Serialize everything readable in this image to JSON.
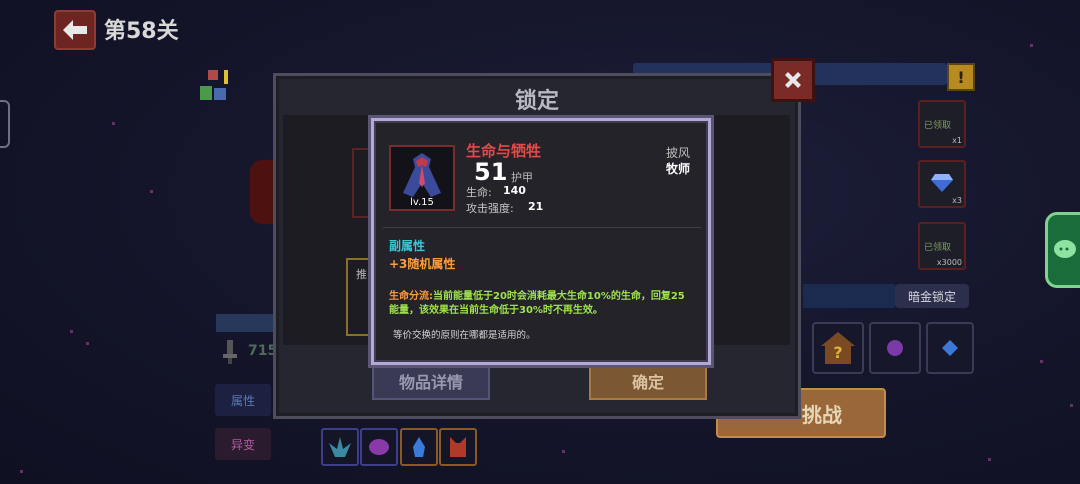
{
  "header": {
    "level_title": "第58关"
  },
  "dialog": {
    "title": "锁定",
    "details_button": "物品详情",
    "confirm_button": "确定",
    "ghost_label": "推"
  },
  "item": {
    "name": "生命与牺牲",
    "level": "lv.15",
    "armor_value": "51",
    "armor_label": "护甲",
    "stats": [
      {
        "label": "生命:",
        "value": "140"
      },
      {
        "label": "攻击强度:",
        "value": "21"
      }
    ],
    "type": "披风",
    "class": "牧师",
    "sub_attr_title": "副属性",
    "sub_attr_value": "+3随机属性",
    "skill_name": "生命分流:",
    "skill_desc": "当前能量低于20时会消耗最大生命10%的生命，回复25能量，该效果在当前生命低于30%时不再生效。",
    "flavor_text": "等价交换的原则在哪都是适用的。"
  },
  "background": {
    "rewards": [
      {
        "tag": "已领取",
        "count": "x1"
      },
      {
        "tag": "",
        "count": "x3"
      },
      {
        "tag": "已领取",
        "count": "x3000"
      }
    ],
    "gold_lock_button": "暗金锁定",
    "challenge_button": "挑战",
    "power_value": "715",
    "attr_tab": "属性",
    "mutation_tab": "异变",
    "warning_mark": "!"
  },
  "colors": {
    "item_name": "#e24a4a",
    "sub_attr_title": "#3ec5d6",
    "accent_orange": "#ff9b3a",
    "skill_desc": "#9fe24c",
    "tooltip_border": "#b3a8d6"
  }
}
